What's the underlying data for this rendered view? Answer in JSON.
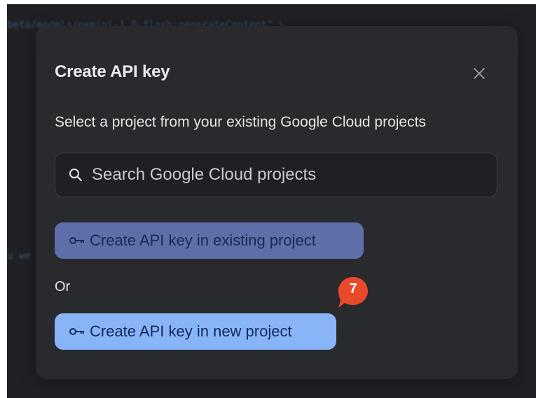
{
  "background": {
    "code_line_1": "beta/models/gemini-1.0-flash:generateContent\" \\",
    "code_line_2": "u we"
  },
  "dialog": {
    "title": "Create API key",
    "close_icon": "close-icon",
    "subtitle": "Select a project from your existing Google Cloud projects",
    "search": {
      "icon": "search-icon",
      "placeholder": "Search Google Cloud projects",
      "value": ""
    },
    "existing_button": {
      "icon": "key-icon",
      "label": "Create API key in existing project"
    },
    "or_label": "Or",
    "new_button": {
      "icon": "key-icon",
      "label": "Create API key in new project"
    },
    "step_badge": "7"
  },
  "colors": {
    "dialog_bg": "#292a2d",
    "existing_button_bg": "#5e6ea8",
    "new_button_bg": "#8ab4f8",
    "badge": "#e8492a"
  }
}
